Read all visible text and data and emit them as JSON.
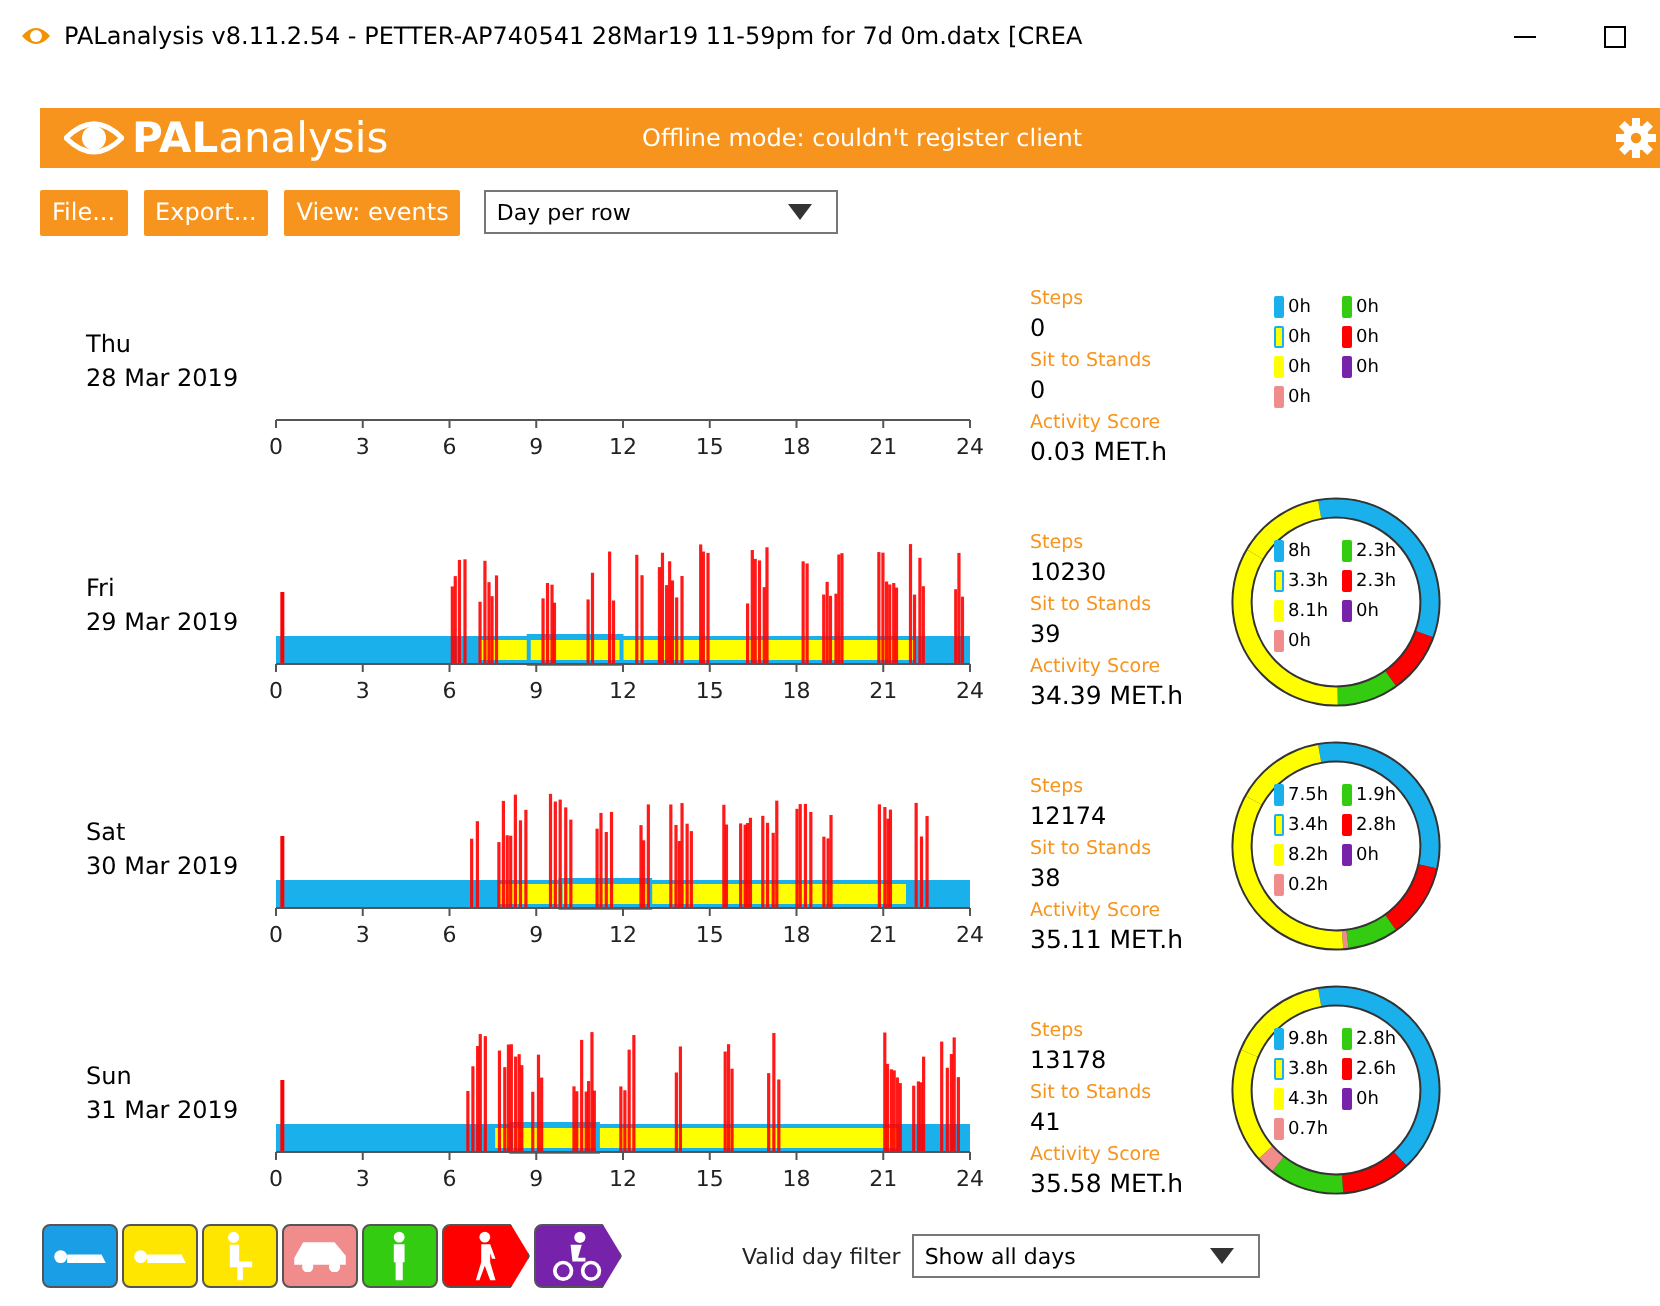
{
  "window": {
    "title": "PALanalysis v8.11.2.54  -  PETTER-AP740541 28Mar19 11-59pm for 7d 0m.datx [CREA"
  },
  "header": {
    "logo_bold": "PAL",
    "logo_light": "analysis",
    "status": "Offline mode: couldn't register client"
  },
  "toolbar": {
    "buttons": [
      "File...",
      "Export...",
      "View: events"
    ],
    "view_select": "Day per row"
  },
  "days": [
    {
      "weekday": "Thu",
      "date": "28 Mar 2019",
      "has_events": false,
      "ticks": [
        "0",
        "3",
        "6",
        "9",
        "12",
        "15",
        "18",
        "21",
        "24"
      ],
      "steps_label": "Steps",
      "steps": "0",
      "sit_to_stands_label": "Sit to Stands",
      "sit_to_stands": "0",
      "activity_score_label": "Activity Score",
      "activity_score": "0.03 MET.h",
      "ring": false,
      "legend": [
        {
          "label": "0h",
          "color": "#1ab0ec",
          "kind": "solid"
        },
        {
          "label": "0h",
          "color": "#ffff00",
          "kind": "outlined"
        },
        {
          "label": "0h",
          "color": "#ffff00",
          "kind": "solid"
        },
        {
          "label": "0h",
          "color": "#f08c8c",
          "kind": "solid"
        },
        {
          "label": "0h",
          "color": "#33cc11",
          "kind": "solid"
        },
        {
          "label": "0h",
          "color": "#ff0000",
          "kind": "solid"
        },
        {
          "label": "0h",
          "color": "#7722aa",
          "kind": "solid"
        }
      ]
    },
    {
      "weekday": "Fri",
      "date": "29 Mar 2019",
      "has_events": true,
      "ticks": [
        "0",
        "3",
        "6",
        "9",
        "12",
        "15",
        "18",
        "21",
        "24"
      ],
      "steps_label": "Steps",
      "steps": "10230",
      "sit_to_stands_label": "Sit to Stands",
      "sit_to_stands": "39",
      "activity_score_label": "Activity Score",
      "activity_score": "34.39 MET.h",
      "ring": true,
      "legend": [
        {
          "label": "8h",
          "color": "#1ab0ec",
          "kind": "solid"
        },
        {
          "label": "3.3h",
          "color": "#ffff00",
          "kind": "outlined"
        },
        {
          "label": "8.1h",
          "color": "#ffff00",
          "kind": "solid"
        },
        {
          "label": "0h",
          "color": "#f08c8c",
          "kind": "solid"
        },
        {
          "label": "2.3h",
          "color": "#33cc11",
          "kind": "solid"
        },
        {
          "label": "2.3h",
          "color": "#ff0000",
          "kind": "solid"
        },
        {
          "label": "0h",
          "color": "#7722aa",
          "kind": "solid"
        }
      ]
    },
    {
      "weekday": "Sat",
      "date": "30 Mar 2019",
      "has_events": true,
      "ticks": [
        "0",
        "3",
        "6",
        "9",
        "12",
        "15",
        "18",
        "21",
        "24"
      ],
      "steps_label": "Steps",
      "steps": "12174",
      "sit_to_stands_label": "Sit to Stands",
      "sit_to_stands": "38",
      "activity_score_label": "Activity Score",
      "activity_score": "35.11 MET.h",
      "ring": true,
      "legend": [
        {
          "label": "7.5h",
          "color": "#1ab0ec",
          "kind": "solid"
        },
        {
          "label": "3.4h",
          "color": "#ffff00",
          "kind": "outlined"
        },
        {
          "label": "8.2h",
          "color": "#ffff00",
          "kind": "solid"
        },
        {
          "label": "0.2h",
          "color": "#f08c8c",
          "kind": "solid"
        },
        {
          "label": "1.9h",
          "color": "#33cc11",
          "kind": "solid"
        },
        {
          "label": "2.8h",
          "color": "#ff0000",
          "kind": "solid"
        },
        {
          "label": "0h",
          "color": "#7722aa",
          "kind": "solid"
        }
      ]
    },
    {
      "weekday": "Sun",
      "date": "31 Mar 2019",
      "has_events": true,
      "ticks": [
        "0",
        "3",
        "6",
        "9",
        "12",
        "15",
        "18",
        "21",
        "24"
      ],
      "steps_label": "Steps",
      "steps": "13178",
      "sit_to_stands_label": "Sit to Stands",
      "sit_to_stands": "41",
      "activity_score_label": "Activity Score",
      "activity_score": "35.58 MET.h",
      "ring": true,
      "legend": [
        {
          "label": "9.8h",
          "color": "#1ab0ec",
          "kind": "solid"
        },
        {
          "label": "3.8h",
          "color": "#ffff00",
          "kind": "outlined"
        },
        {
          "label": "4.3h",
          "color": "#ffff00",
          "kind": "solid"
        },
        {
          "label": "0.7h",
          "color": "#f08c8c",
          "kind": "solid"
        },
        {
          "label": "2.8h",
          "color": "#33cc11",
          "kind": "solid"
        },
        {
          "label": "2.6h",
          "color": "#ff0000",
          "kind": "solid"
        },
        {
          "label": "0h",
          "color": "#7722aa",
          "kind": "solid"
        }
      ]
    }
  ],
  "activity_buttons": [
    {
      "kind": "lying",
      "color": "#1a9ee6"
    },
    {
      "kind": "lying",
      "color": "#ffe600"
    },
    {
      "kind": "sitting",
      "color": "#ffe600"
    },
    {
      "kind": "car",
      "color": "#f08c8c"
    },
    {
      "kind": "standing",
      "color": "#33cc11"
    },
    {
      "kind": "walking",
      "color": "#ff0000"
    },
    {
      "kind": "cycling",
      "color": "#7722aa"
    }
  ],
  "footer": {
    "filter_label": "Valid day filter",
    "filter_select": "Show all days"
  }
}
